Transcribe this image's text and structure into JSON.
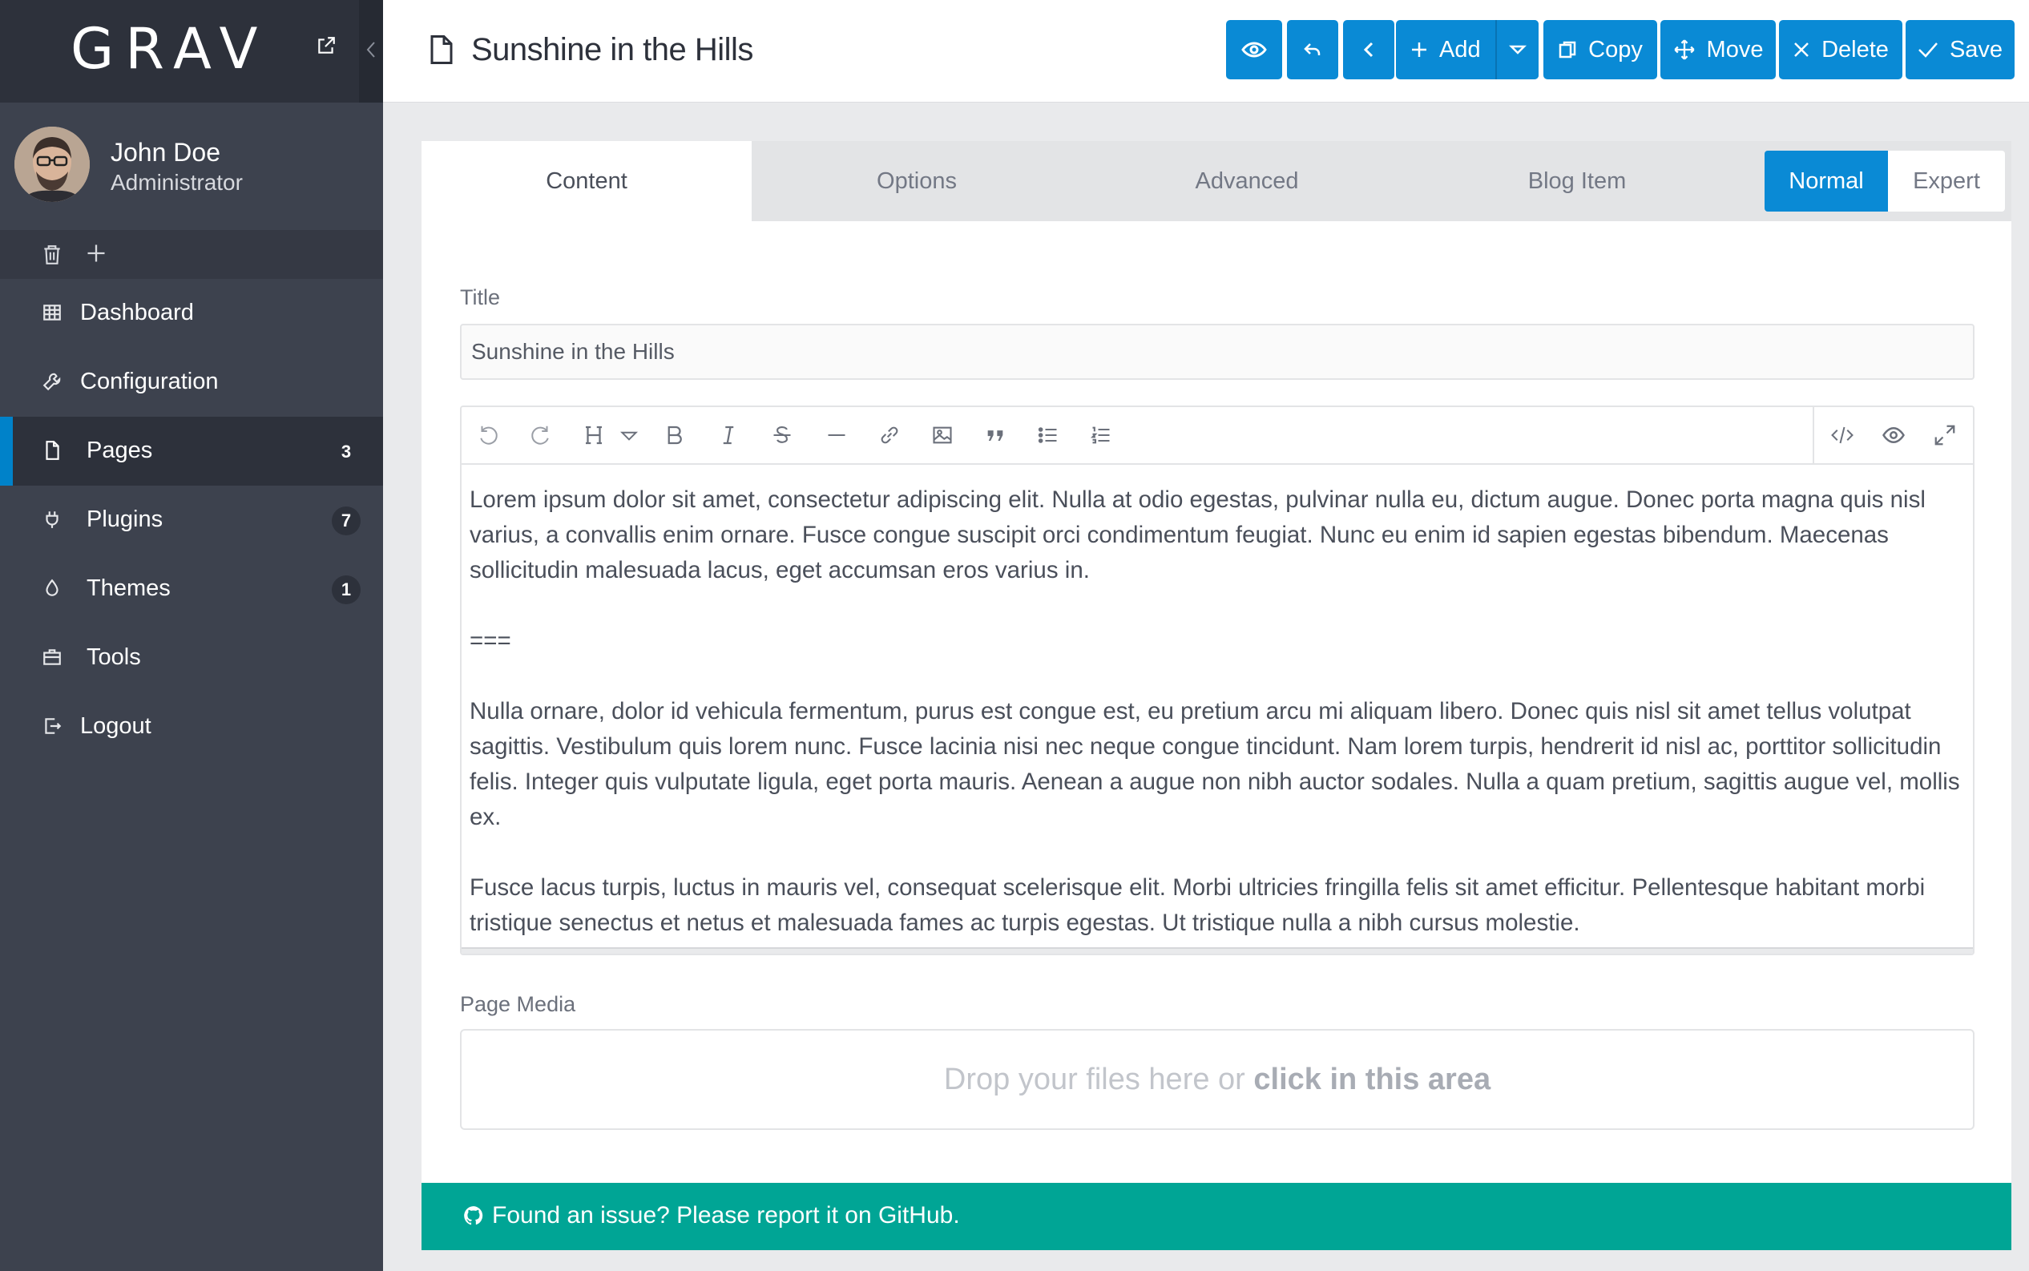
{
  "sidebar": {
    "logo": "GRAV",
    "user": {
      "name": "John Doe",
      "role": "Administrator"
    },
    "nav": [
      {
        "label": "Dashboard",
        "badge": ""
      },
      {
        "label": "Configuration",
        "badge": ""
      },
      {
        "label": "Pages",
        "badge": "3"
      },
      {
        "label": "Plugins",
        "badge": "7"
      },
      {
        "label": "Themes",
        "badge": "1"
      },
      {
        "label": "Tools",
        "badge": ""
      },
      {
        "label": "Logout",
        "badge": ""
      }
    ],
    "active_item": "Pages"
  },
  "topbar": {
    "title": "Sunshine in the Hills",
    "buttons": {
      "add": "Add",
      "copy": "Copy",
      "move": "Move",
      "delete": "Delete",
      "save": "Save"
    }
  },
  "tabs": [
    "Content",
    "Options",
    "Advanced",
    "Blog Item"
  ],
  "active_tab": "Content",
  "mode": {
    "normal": "Normal",
    "expert": "Expert",
    "selected": "Normal"
  },
  "form": {
    "title_label": "Title",
    "title_value": "Sunshine in the Hills",
    "content": {
      "p1": "Lorem ipsum dolor sit amet, consectetur adipiscing elit. Nulla at odio egestas, pulvinar nulla eu, dictum augue. Donec porta magna quis nisl varius, a convallis enim ornare. Fusce congue suscipit orci condimentum feugiat. Nunc eu enim id sapien egestas bibendum. Maecenas sollicitudin malesuada lacus, eget accumsan eros varius in.",
      "separator": "===",
      "p2": "Nulla ornare, dolor id vehicula fermentum, purus est congue est, eu pretium arcu mi aliquam libero. Donec quis nisl sit amet tellus volutpat sagittis. Vestibulum quis lorem nunc. Fusce lacinia nisi nec neque congue tincidunt. Nam lorem turpis, hendrerit id nisl ac, porttitor sollicitudin felis. Integer quis vulputate ligula, eget porta mauris. Aenean a augue non nibh auctor sodales. Nulla a quam pretium, sagittis augue vel, mollis ex.",
      "p3": "Fusce lacus turpis, luctus in mauris vel, consequat scelerisque elit. Morbi ultricies fringilla felis sit amet efficitur. Pellentesque habitant morbi tristique senectus et netus et malesuada fames ac turpis egestas. Ut tristique nulla a nibh cursus molestie."
    },
    "media_label": "Page Media",
    "dropzone_text": "Drop your files here or ",
    "dropzone_link": "click in this area"
  },
  "footer": {
    "text": "Found an issue? Please report it on GitHub."
  },
  "colors": {
    "sidebar_bg": "#3d424e",
    "sidebar_dark": "#2d313b",
    "accent_blue": "#0a8ad5",
    "footer_teal": "#00a595"
  }
}
